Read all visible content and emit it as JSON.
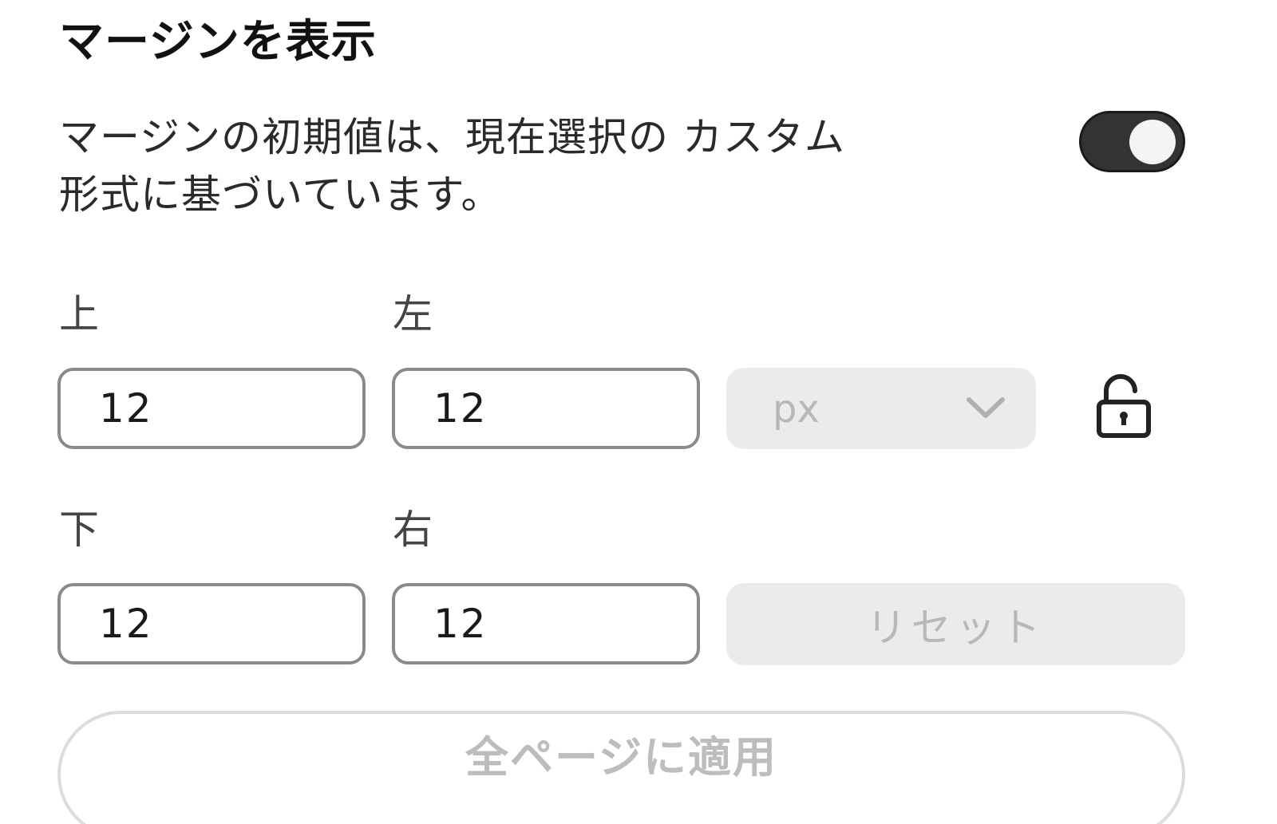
{
  "section": {
    "title": "マージンを表示",
    "description_line1": "マージンの初期値は、現在選択の カスタム",
    "description_line2": "形式に基づいています。",
    "toggle_on": true
  },
  "margins": {
    "top": {
      "label": "上",
      "value": "12"
    },
    "left": {
      "label": "左",
      "value": "12"
    },
    "bottom": {
      "label": "下",
      "value": "12"
    },
    "right": {
      "label": "右",
      "value": "12"
    }
  },
  "unit": {
    "selected": "px",
    "icon": "chevron-down-icon"
  },
  "lock": {
    "icon": "unlock-icon"
  },
  "buttons": {
    "reset_label": "リセット",
    "apply_all_label": "全ページに適用"
  },
  "colors": {
    "toggle_track": "#333333",
    "disabled_bg": "#ebebeb",
    "disabled_text": "#b8b8b8",
    "input_border": "#8a8a8a"
  }
}
